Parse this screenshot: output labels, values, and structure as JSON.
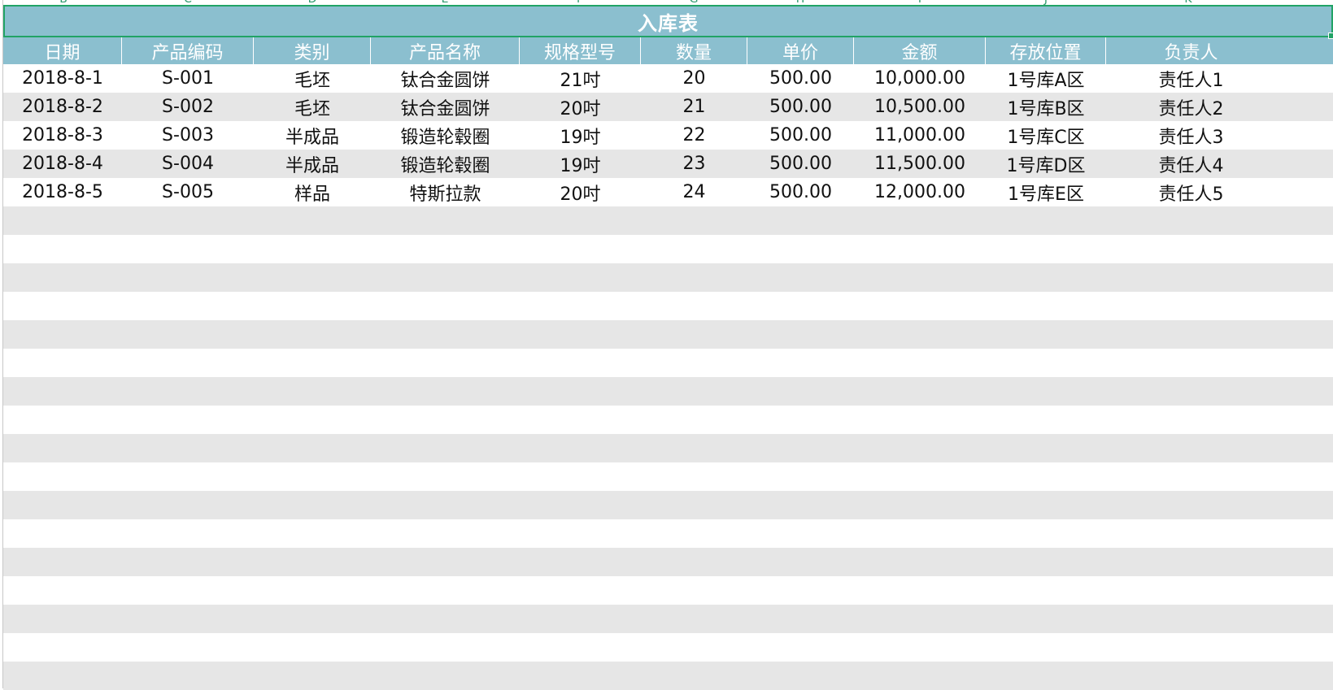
{
  "column_letters": [
    "B",
    "C",
    "D",
    "E",
    "F",
    "G",
    "H",
    "I",
    "J",
    "K"
  ],
  "sheet": {
    "title": "入库表",
    "headers": [
      "日期",
      "产品编码",
      "类别",
      "产品名称",
      "规格型号",
      "数量",
      "单价",
      "金额",
      "存放位置",
      "负责人"
    ],
    "rows": [
      [
        "2018-8-1",
        "S-001",
        "毛坯",
        "钛合金圆饼",
        "21吋",
        "20",
        "500.00",
        "10,000.00",
        "1号库A区",
        "责任人1"
      ],
      [
        "2018-8-2",
        "S-002",
        "毛坯",
        "钛合金圆饼",
        "20吋",
        "21",
        "500.00",
        "10,500.00",
        "1号库B区",
        "责任人2"
      ],
      [
        "2018-8-3",
        "S-003",
        "半成品",
        "锻造轮毂圈",
        "19吋",
        "22",
        "500.00",
        "11,000.00",
        "1号库C区",
        "责任人3"
      ],
      [
        "2018-8-4",
        "S-004",
        "半成品",
        "锻造轮毂圈",
        "19吋",
        "23",
        "500.00",
        "11,500.00",
        "1号库D区",
        "责任人4"
      ],
      [
        "2018-8-5",
        "S-005",
        "样品",
        "特斯拉款",
        "20吋",
        "24",
        "500.00",
        "12,000.00",
        "1号库E区",
        "责任人5"
      ]
    ]
  },
  "colors": {
    "header_bg": "#8bbfcf",
    "band_bg": "#e6e6e6",
    "selection_border": "#21a366"
  }
}
